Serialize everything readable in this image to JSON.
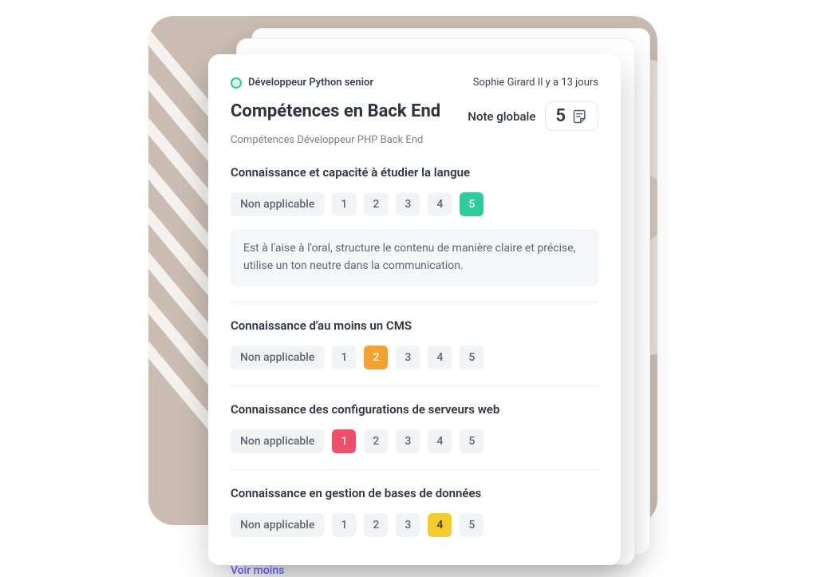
{
  "header": {
    "job": "Développeur Python senior",
    "author": "Sophie Girard",
    "when": "Il y a 13 jours"
  },
  "title": "Compétences en Back End",
  "subtitle": "Compétences Développeur PHP Back End",
  "global_label": "Note globale",
  "global_score": "5",
  "na_label": "Non applicable",
  "scale": [
    "1",
    "2",
    "3",
    "4",
    "5"
  ],
  "sections": [
    {
      "q": "Connaissance et capacité à étudier la langue",
      "selected": 5,
      "note": "Est à l'aise à l'oral, structure le contenu de manière claire et précise, utilise un ton neutre dans la communication."
    },
    {
      "q": "Connaissance d'au moins un CMS",
      "selected": 2
    },
    {
      "q": "Connaissance des configurations de serveurs web",
      "selected": 1
    },
    {
      "q": "Connaissance en gestion de bases de données",
      "selected": 4
    }
  ],
  "see_less": "Voir moins",
  "colors": {
    "5": "c5",
    "2": "c2",
    "1": "c1",
    "4": "c4"
  }
}
